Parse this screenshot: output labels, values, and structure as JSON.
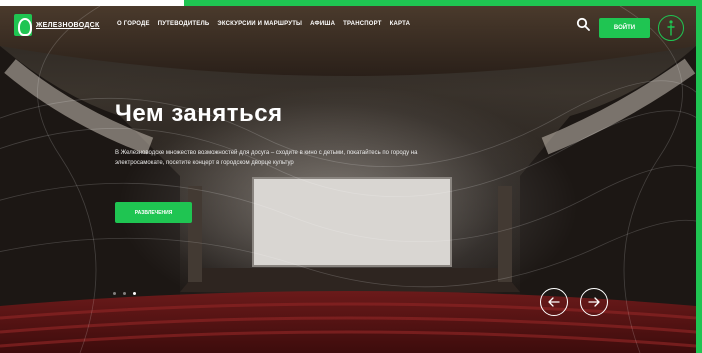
{
  "header": {
    "logo_text": "ЖЕЛЕЗНОВОДСК",
    "nav": [
      {
        "label": "О ГОРОДЕ"
      },
      {
        "label": "ПУТЕВОДИТЕЛЬ"
      },
      {
        "label": "ЭКСКУРСИИ И МАРШРУТЫ"
      },
      {
        "label": "АФИША"
      },
      {
        "label": "ТРАНСПОРТ"
      },
      {
        "label": "КАРТА"
      }
    ],
    "login_label": "ВОЙТИ"
  },
  "hero": {
    "title": "Чем заняться",
    "description": "В Железноводске множество возможностей для досуга – сходите в кино с детьми, покатайтесь по городу на электросамокате, посетите концерт в городском дворце культур",
    "cta_label": "РАЗВЛЕЧЕНИЯ",
    "slides_count": 3,
    "active_slide": 3
  },
  "icons": {
    "search": "search-icon",
    "accessibility": "accessibility-icon",
    "prev": "arrow-left-icon",
    "next": "arrow-right-icon"
  },
  "colors": {
    "accent": "#1fc552",
    "text": "#ffffff"
  }
}
